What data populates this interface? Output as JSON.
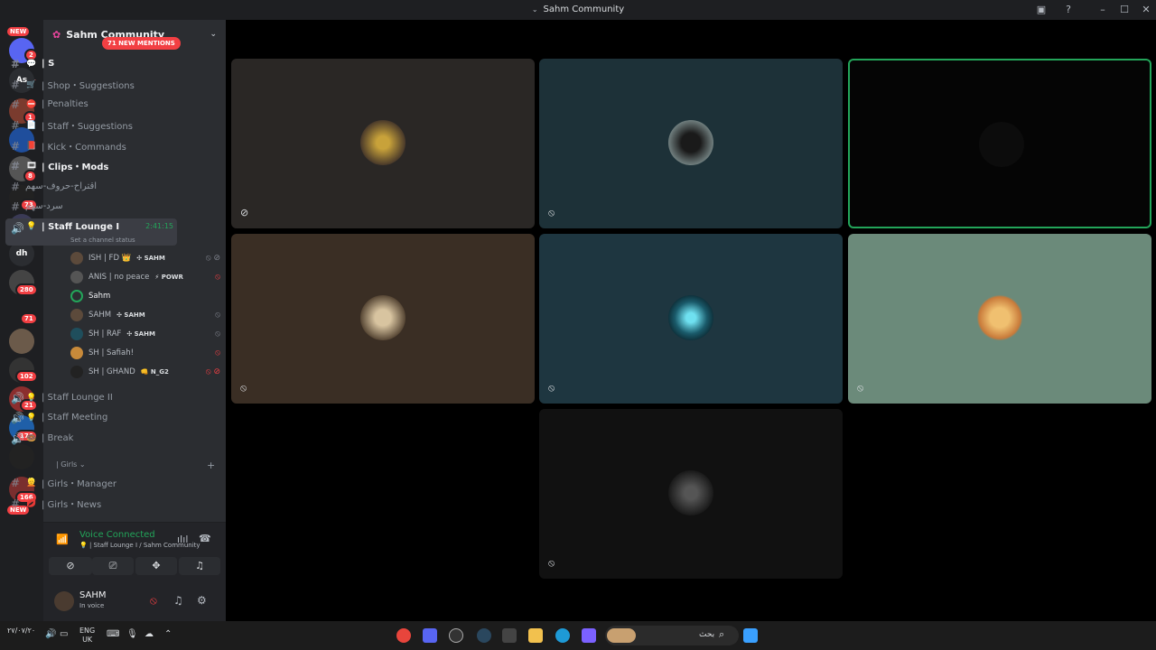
{
  "window": {
    "title": "Sahm Community"
  },
  "server_rail": {
    "badges": [
      "NEW",
      "2",
      "1",
      "8",
      "73",
      "98",
      "280",
      "71",
      "102",
      "21",
      "176",
      "166",
      "NEW"
    ],
    "labels": [
      "As",
      "dh"
    ]
  },
  "guild": {
    "name": "Sahm Community"
  },
  "mentions_pill": "71 NEW MENTIONS",
  "channels": [
    {
      "emoji": "💬",
      "label": "| S"
    },
    {
      "emoji": "🛒",
      "label": "| Shop・Suggestions"
    },
    {
      "emoji": "⛔",
      "label": "| Penalties"
    },
    {
      "emoji": "📄",
      "label": "| Staff・Suggestions"
    },
    {
      "emoji": "📕",
      "label": "| Kick・Commands"
    },
    {
      "emoji": "🎞",
      "label": "| Clips・Mods"
    },
    {
      "emoji": "",
      "label": "اقتراح-حروف-سهم"
    },
    {
      "emoji": "",
      "label": "سرد-سهم"
    }
  ],
  "active_voice": {
    "emoji": "💡",
    "label": "| Staff Lounge I",
    "timer": "2:41:15",
    "status": "Set a channel status"
  },
  "voice_users": [
    {
      "name": "ISH | FD 👑",
      "tag": "✣ SAHM"
    },
    {
      "name": "ANIS | no peace",
      "tag": "⚡ POWR"
    },
    {
      "name": "Sahm",
      "tag": ""
    },
    {
      "name": "SAHM",
      "tag": "✣ SAHM"
    },
    {
      "name": "SH | RAF",
      "tag": "✣ SAHM"
    },
    {
      "name": "SH | Safiah!",
      "tag": ""
    },
    {
      "name": "SH | GHAND",
      "tag": "👊 N_G2"
    }
  ],
  "voice_channels": [
    {
      "emoji": "💡",
      "label": "| Staff Lounge II"
    },
    {
      "emoji": "💡",
      "label": "| Staff Meeting"
    },
    {
      "emoji": "🍩",
      "label": "| Break"
    }
  ],
  "category": {
    "label": "| Girls ⌄"
  },
  "girls_channels": [
    {
      "emoji": "👱",
      "label": "| Girls・Manager"
    },
    {
      "emoji": "💋",
      "label": "| Girls・News"
    }
  ],
  "voice_panel": {
    "title": "Voice Connected",
    "subtitle": "💡 | Staff Lounge I / Sahm Community"
  },
  "user": {
    "name": "SAHM",
    "status": "In voice"
  },
  "taskbar": {
    "date": "٢٧/٠٧/٢٠",
    "lang": "ENG",
    "region": "UK",
    "search_label": "بحث"
  }
}
